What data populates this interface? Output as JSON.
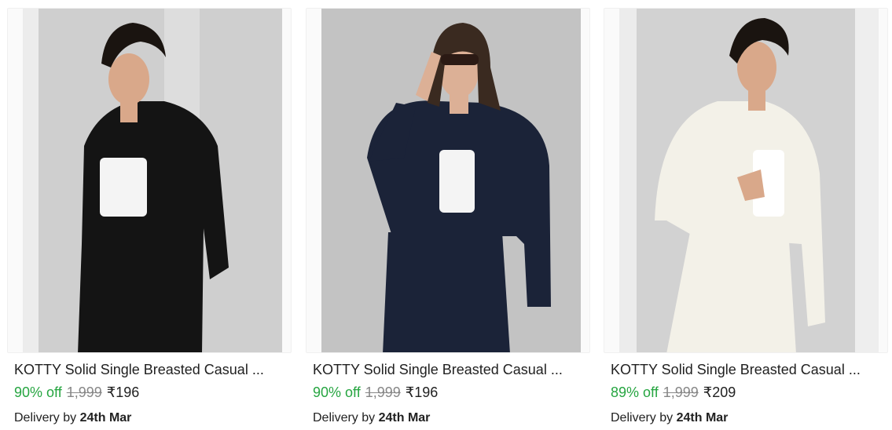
{
  "products": [
    {
      "title": "KOTTY Solid Single Breasted Casual ...",
      "discount": "90% off",
      "mrp": "1,999",
      "price": "₹196",
      "delivery_prefix": "Delivery by",
      "delivery_date": "24th Mar",
      "colors": {
        "backdrop": "#cfcfcf",
        "garment": "#141414",
        "top": "#f4f4f4",
        "hair": "#1a1410",
        "skin": "#d9a88a"
      }
    },
    {
      "title": "KOTTY Solid Single Breasted Casual ...",
      "discount": "90% off",
      "mrp": "1,999",
      "price": "₹196",
      "delivery_prefix": "Delivery by",
      "delivery_date": "24th Mar",
      "colors": {
        "backdrop": "#b9b9b9",
        "garment": "#1b2338",
        "top": "#f4f4f4",
        "hair": "#3a2a20",
        "skin": "#dcb096"
      }
    },
    {
      "title": "KOTTY Solid Single Breasted Casual ...",
      "discount": "89% off",
      "mrp": "1,999",
      "price": "₹209",
      "delivery_prefix": "Delivery by",
      "delivery_date": "24th Mar",
      "colors": {
        "backdrop": "#d2d2d2",
        "garment": "#f3f1e8",
        "top": "#ffffff",
        "hair": "#1a1410",
        "skin": "#d9a88a"
      }
    }
  ],
  "colors": {
    "discount_green": "#26a541",
    "mrp_grey": "#878787",
    "text": "#212121"
  }
}
